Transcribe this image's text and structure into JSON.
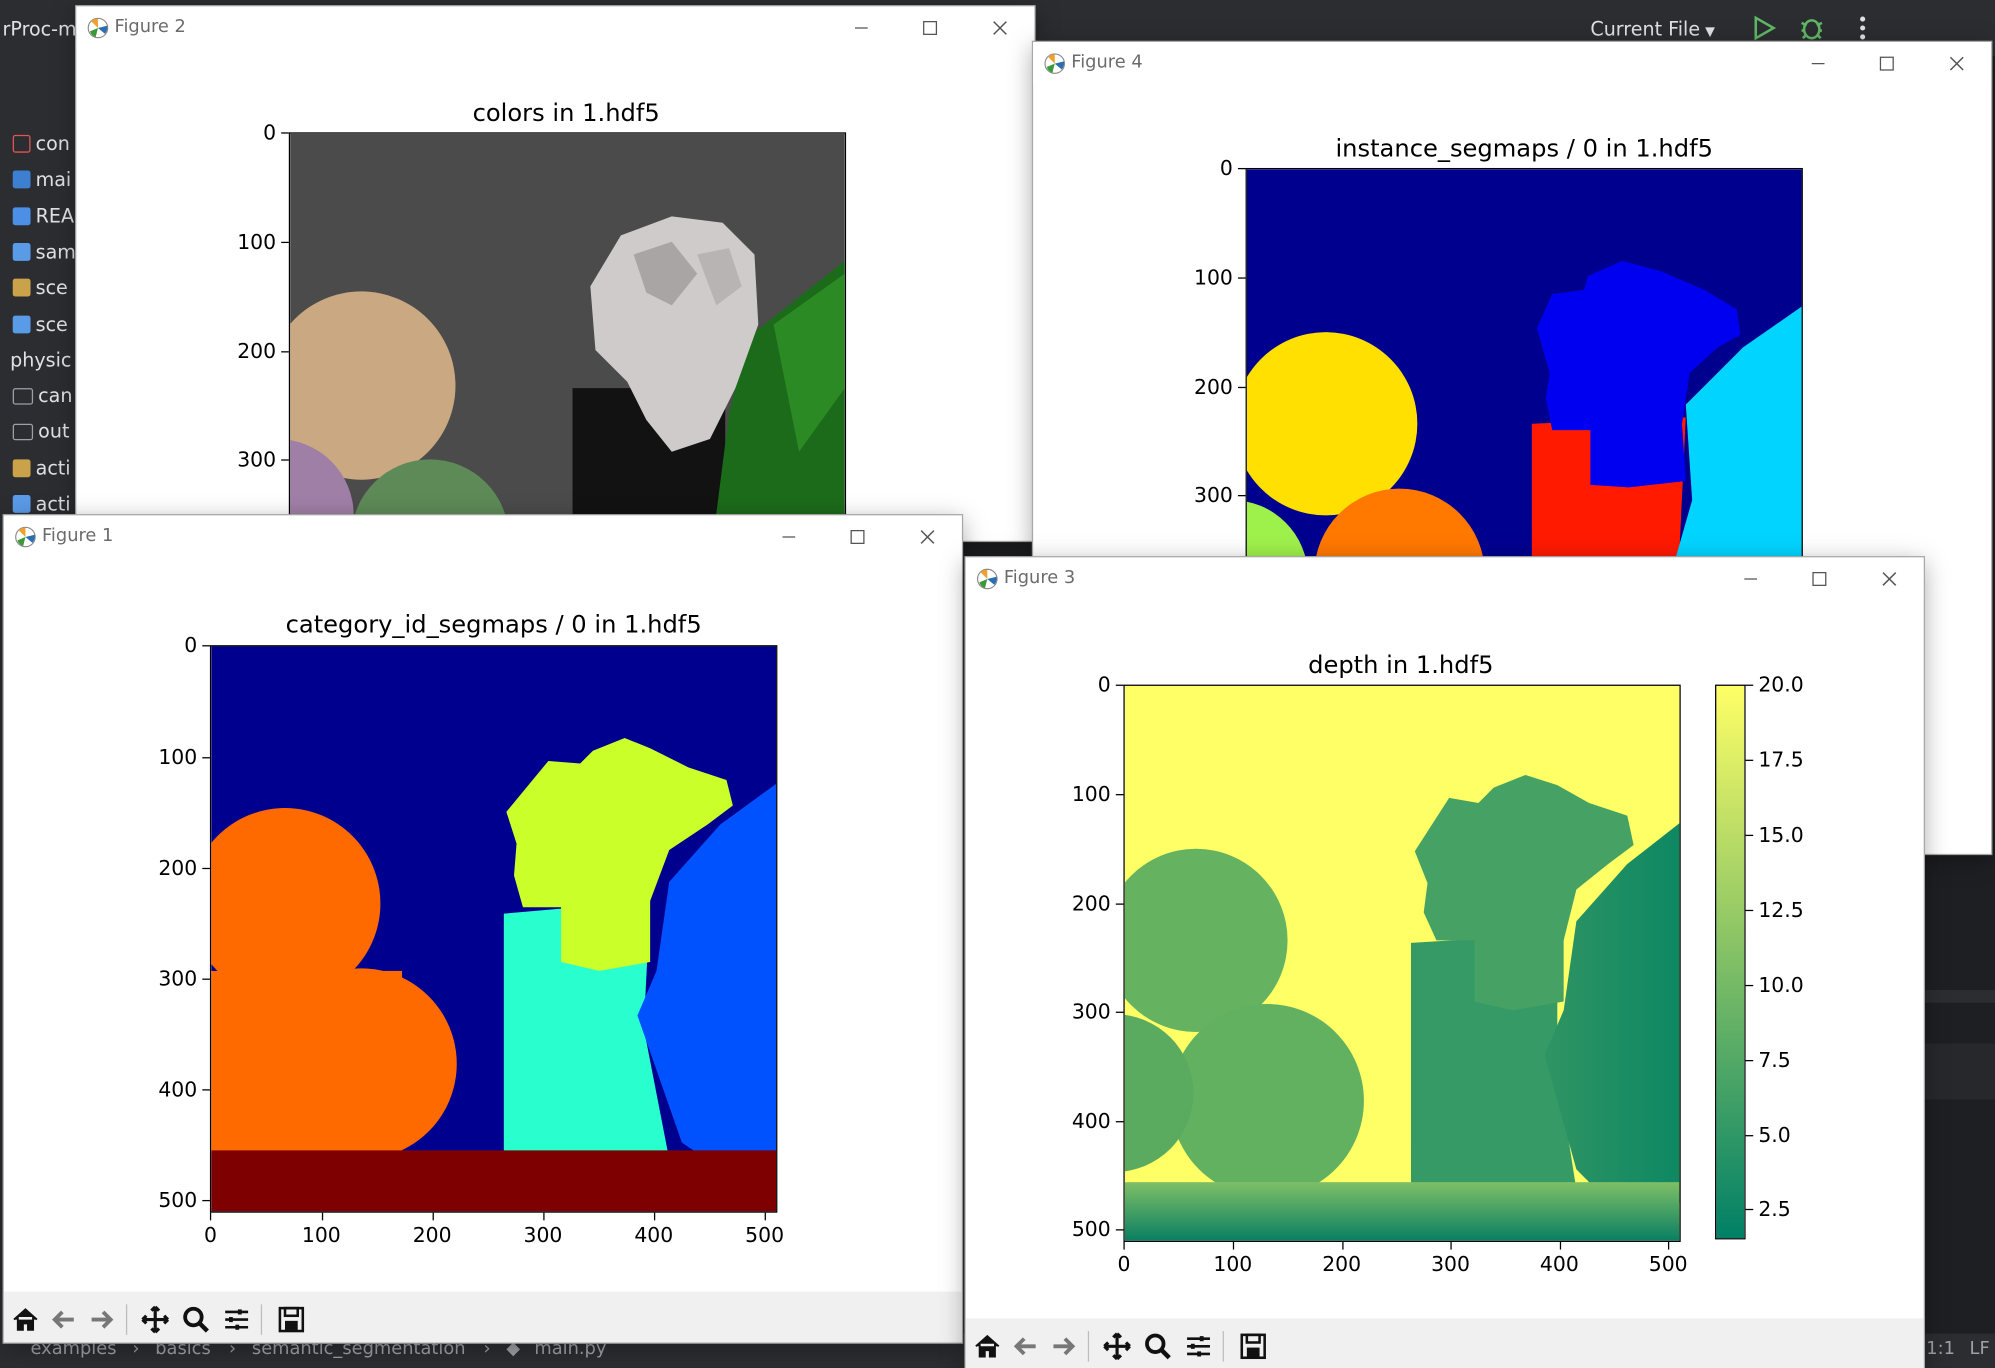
{
  "ide": {
    "title_fragment": "rProc-m",
    "run_config": "Current File",
    "project_items": [
      {
        "label": "con",
        "icon": "yaml-file-icon",
        "color": "#e05555"
      },
      {
        "label": "mai",
        "icon": "python-file-icon",
        "color": "#3d7fd1"
      },
      {
        "label": "REA",
        "icon": "markdown-file-icon",
        "color": "#4c8fe6"
      },
      {
        "label": "sam",
        "icon": "image-file-icon",
        "color": "#5a9be8"
      },
      {
        "label": "sce",
        "icon": "blend-file-icon",
        "color": "#c9a24a"
      },
      {
        "label": "sce",
        "icon": "blend-file-icon",
        "color": "#5a9be8"
      },
      {
        "label": "physic",
        "icon": "folder-icon",
        "color": "#9da0a8"
      },
      {
        "label": "can",
        "icon": "folder-icon",
        "color": "#9da0a8"
      },
      {
        "label": "out",
        "icon": "folder-icon",
        "color": "#9da0a8"
      },
      {
        "label": "acti",
        "icon": "blend-file-icon",
        "color": "#c9a24a"
      },
      {
        "label": "acti",
        "icon": "blend-file-icon",
        "color": "#5a9be8"
      }
    ],
    "breadcrumb": [
      "examples",
      "basics",
      "semantic_segmentation",
      "main.py"
    ],
    "status_pos": "1:1",
    "status_lf": "LF"
  },
  "windows": {
    "fig2": {
      "title": "Figure 2",
      "plot_title": "colors in 1.hdf5"
    },
    "fig4": {
      "title": "Figure 4",
      "plot_title": "instance_segmaps / 0 in 1.hdf5"
    },
    "fig1": {
      "title": "Figure 1",
      "plot_title": "category_id_segmaps / 0 in 1.hdf5"
    },
    "fig3": {
      "title": "Figure 3",
      "plot_title": "depth in 1.hdf5"
    }
  },
  "toolbar_icons": [
    "home-icon",
    "back-arrow-icon",
    "forward-arrow-icon",
    "pan-icon",
    "zoom-icon",
    "configure-subplots-icon",
    "save-icon"
  ],
  "chart_data": [
    {
      "figure": "Figure 2",
      "type": "image",
      "title": "colors in 1.hdf5",
      "yticks": [
        0,
        100,
        200,
        300
      ],
      "ylim": [
        0,
        512
      ]
    },
    {
      "figure": "Figure 4",
      "type": "image",
      "title": "instance_segmaps / 0 in 1.hdf5",
      "yticks": [
        0,
        100,
        200,
        300
      ],
      "ylim": [
        0,
        512
      ]
    },
    {
      "figure": "Figure 1",
      "type": "image",
      "title": "category_id_segmaps / 0 in 1.hdf5",
      "xticks": [
        0,
        100,
        200,
        300,
        400,
        500
      ],
      "yticks": [
        0,
        100,
        200,
        300,
        400,
        500
      ],
      "xlim": [
        0,
        512
      ],
      "ylim": [
        0,
        512
      ]
    },
    {
      "figure": "Figure 3",
      "type": "heatmap",
      "title": "depth in 1.hdf5",
      "xticks": [
        0,
        100,
        200,
        300,
        400,
        500
      ],
      "yticks": [
        0,
        100,
        200,
        300,
        400,
        500
      ],
      "xlim": [
        0,
        512
      ],
      "ylim": [
        0,
        512
      ],
      "colorbar_ticks": [
        "20.0",
        "17.5",
        "15.0",
        "12.5",
        "10.0",
        "7.5",
        "5.0",
        "2.5"
      ],
      "colorbar_range": [
        1.5,
        20.0
      ],
      "colormap": "summer"
    }
  ]
}
